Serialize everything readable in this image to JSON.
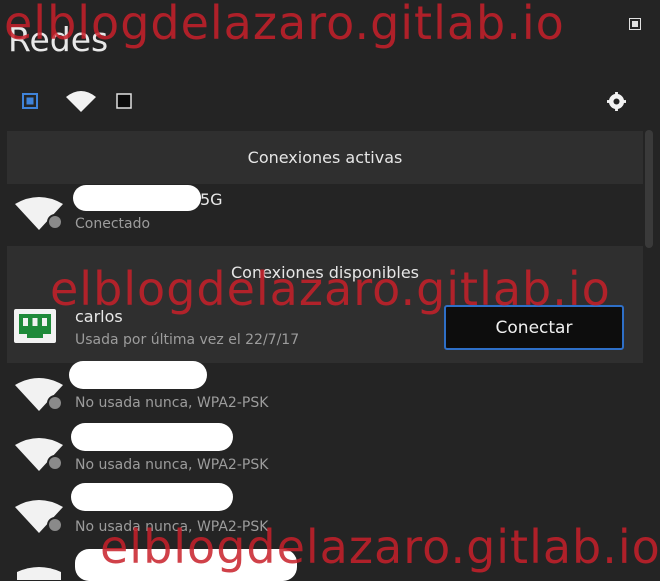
{
  "window": {
    "title": "Redes"
  },
  "toolbar": {
    "icons": [
      "wired-icon",
      "wifi-icon",
      "vpn-icon",
      "settings-icon"
    ]
  },
  "sections": {
    "active": {
      "label": "Conexiones activas"
    },
    "available": {
      "label": "Conexiones disponibles"
    }
  },
  "active_connections": [
    {
      "ssid_suffix": "5G",
      "status": "Conectado"
    }
  ],
  "available_connections": [
    {
      "name": "carlos",
      "status": "Usada por última vez el 22/7/17",
      "action": "Conectar"
    },
    {
      "status": "No usada nunca, WPA2-PSK"
    },
    {
      "status": "No usada nunca, WPA2-PSK"
    },
    {
      "status": "No usada nunca, WPA2-PSK"
    }
  ],
  "watermark": "elblogdelazaro.gitlab.io",
  "colors": {
    "accent": "#2e6fc7",
    "watermark": "#c8202a",
    "background": "#242424"
  }
}
